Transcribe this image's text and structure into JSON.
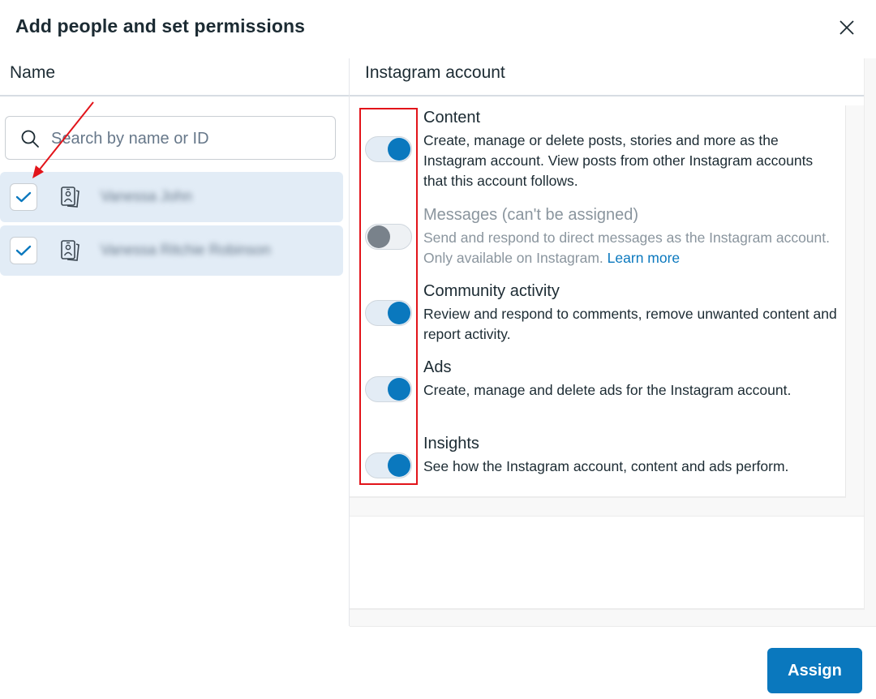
{
  "dialog": {
    "title": "Add people and set permissions",
    "close_icon": "close-icon"
  },
  "left_column": {
    "header": "Name",
    "search": {
      "placeholder": "Search by name or ID",
      "value": "",
      "icon": "search-icon"
    },
    "people": [
      {
        "name": "Vanessa John",
        "checked": true,
        "icon": "id-badge-icon",
        "blurred": true
      },
      {
        "name": "Vanessa Ritchie Robinson",
        "checked": true,
        "icon": "id-badge-icon",
        "blurred": true
      }
    ]
  },
  "right_column": {
    "header": "Instagram account",
    "permissions": [
      {
        "title": "Content",
        "description": "Create, manage or delete posts, stories and more as the Instagram account. View posts from other Instagram accounts that this account follows.",
        "enabled": true,
        "disabled": false
      },
      {
        "title": "Messages (can't be assigned)",
        "description": "Send and respond to direct messages as the Instagram account. Only available on Instagram.",
        "link": "Learn more",
        "enabled": false,
        "disabled": true
      },
      {
        "title": "Community activity",
        "description": "Review and respond to comments, remove unwanted content and report activity.",
        "enabled": true,
        "disabled": false
      },
      {
        "title": "Ads",
        "description": "Create, manage and delete ads for the Instagram account.",
        "enabled": true,
        "disabled": false
      },
      {
        "title": "Insights",
        "description": "See how the Instagram account, content and ads perform.",
        "enabled": true,
        "disabled": false
      }
    ]
  },
  "footer": {
    "assign_label": "Assign"
  },
  "annotations": {
    "highlight_color": "#e2141a",
    "arrow_color": "#e2141a"
  },
  "colors": {
    "accent": "#0a78be",
    "row_selected_bg": "#e2ecf6",
    "text_primary": "#1c2b33",
    "text_disabled": "#8a959e"
  }
}
